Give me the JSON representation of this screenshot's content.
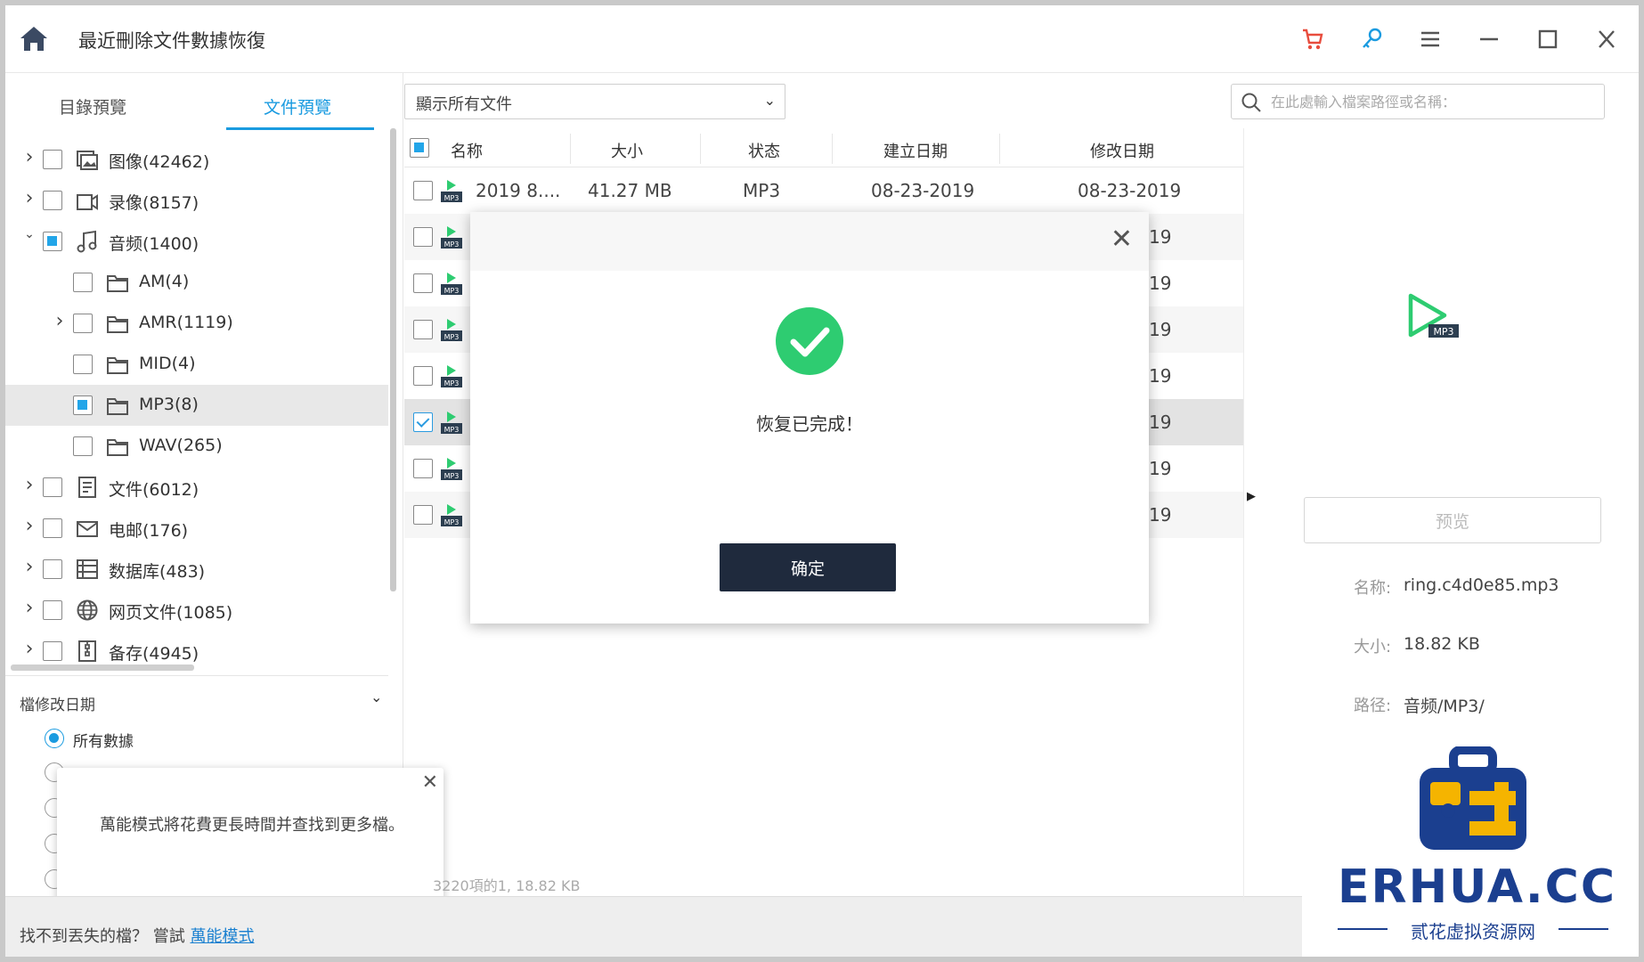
{
  "app": {
    "title": "最近刪除文件數據恢復"
  },
  "tabs": [
    "目錄預覽",
    "文件預覽"
  ],
  "tree": [
    {
      "label": "图像(42462)",
      "icon": "image-icon",
      "level": 0,
      "expand": "collapsed",
      "check": "none",
      "selected": false
    },
    {
      "label": "录像(8157)",
      "icon": "video-icon",
      "level": 0,
      "expand": "collapsed",
      "check": "none",
      "selected": false
    },
    {
      "label": "音频(1400)",
      "icon": "music-icon",
      "level": 0,
      "expand": "expanded",
      "check": "partial",
      "selected": false
    },
    {
      "label": "AM(4)",
      "icon": "folder-icon",
      "level": 1,
      "expand": "none",
      "check": "none",
      "selected": false
    },
    {
      "label": "AMR(1119)",
      "icon": "folder-icon",
      "level": 1,
      "expand": "collapsed",
      "check": "none",
      "selected": false
    },
    {
      "label": "MID(4)",
      "icon": "folder-icon",
      "level": 1,
      "expand": "none",
      "check": "none",
      "selected": false
    },
    {
      "label": "MP3(8)",
      "icon": "folder-icon",
      "level": 1,
      "expand": "none",
      "check": "partial",
      "selected": true
    },
    {
      "label": "WAV(265)",
      "icon": "folder-icon",
      "level": 1,
      "expand": "none",
      "check": "none",
      "selected": false
    },
    {
      "label": "文件(6012)",
      "icon": "document-icon",
      "level": 0,
      "expand": "collapsed",
      "check": "none",
      "selected": false
    },
    {
      "label": "电邮(176)",
      "icon": "email-icon",
      "level": 0,
      "expand": "collapsed",
      "check": "none",
      "selected": false
    },
    {
      "label": "数据库(483)",
      "icon": "database-icon",
      "level": 0,
      "expand": "collapsed",
      "check": "none",
      "selected": false
    },
    {
      "label": "网页文件(1085)",
      "icon": "globe-icon",
      "level": 0,
      "expand": "collapsed",
      "check": "none",
      "selected": false
    },
    {
      "label": "备存(4945)",
      "icon": "archive-icon",
      "level": 0,
      "expand": "collapsed",
      "check": "none",
      "selected": false
    }
  ],
  "filter_panel": {
    "title": "檔修改日期",
    "options": [
      {
        "label": "所有數據",
        "selected": true
      }
    ]
  },
  "tooltip": {
    "text": "萬能模式將花費更長時間并查找到更多檔。"
  },
  "bottom": {
    "prefix": "找不到丟失的檔？ 嘗試 ",
    "link": "萬能模式"
  },
  "status": {
    "text": "3220項的1, 18.82 KB"
  },
  "filter_dropdown": {
    "value": "顯示所有文件"
  },
  "search": {
    "placeholder": "在此處輸入檔案路徑或名稱："
  },
  "table": {
    "columns": [
      "名称",
      "大小",
      "状态",
      "建立日期",
      "修改日期"
    ],
    "first_row": {
      "name": "2019 8....",
      "size": "41.27  MB",
      "status": "MP3",
      "created": "08-23-2019",
      "modified": "08-23-2019"
    },
    "partial_rows": [
      {
        "modified_tail": "19",
        "checked": false
      },
      {
        "modified_tail": "19",
        "checked": false
      },
      {
        "modified_tail": "19",
        "checked": false
      },
      {
        "modified_tail": "19",
        "checked": false
      },
      {
        "modified_tail": "19",
        "checked": true
      },
      {
        "modified_tail": "19",
        "checked": false
      },
      {
        "modified_tail": "19",
        "checked": false
      }
    ]
  },
  "preview": {
    "button": "预览",
    "name_label": "名称:",
    "name_value": "ring.c4d0e85.mp3",
    "size_label": "大小:",
    "size_value": "18.82  KB",
    "path_label": "路径:",
    "path_value": "音频/MP3/"
  },
  "modal": {
    "message": "恢复已完成！",
    "ok": "确定"
  },
  "watermark": {
    "brand": "ERHUA.CC",
    "sub": "贰花虚拟资源网"
  },
  "colors": {
    "accent": "#1a9be0",
    "success": "#2ecc71",
    "button_dark": "#1f2a3d",
    "cart": "#e84c3d",
    "key": "#1a9be0",
    "brand": "#1b3f8f",
    "brand_yellow": "#f5b400"
  }
}
